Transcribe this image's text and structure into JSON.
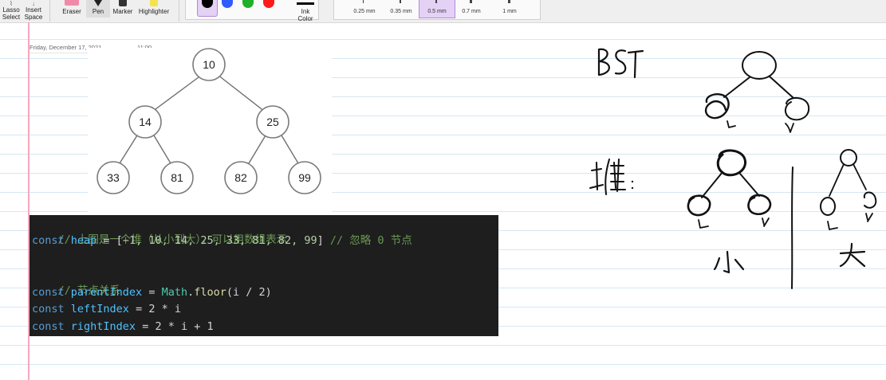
{
  "ribbon": {
    "lasso_label": "Lasso\nSelect",
    "lasso_line1": "Lasso",
    "lasso_line2": "Select",
    "insert_line1": "Insert",
    "insert_line2": "Space",
    "eraser_label": "Eraser",
    "pen_label": "Pen",
    "marker_label": "Marker",
    "highlighter_label": "Highlighter",
    "ink_color_line1": "Ink",
    "ink_color_line2": "Color",
    "colors": [
      "#000000",
      "#2f5bff",
      "#1fb02a",
      "#ff1a1a"
    ],
    "selected_color": "#000000",
    "thickness_options": [
      "0.25 mm",
      "0.35 mm",
      "0.5 mm",
      "0.7 mm",
      "1 mm"
    ],
    "selected_thickness": "0.5 mm"
  },
  "page": {
    "date": "Friday, December 17, 2021",
    "time": "11:00"
  },
  "heap_tree": {
    "nodes": [
      "10",
      "14",
      "25",
      "33",
      "81",
      "82",
      "99"
    ]
  },
  "code": {
    "line1_comment": "// 上图是一个堆（从小到大），可以用数组表示",
    "line2": {
      "kw": "const",
      "var": "heap",
      "eq": " = [",
      "values": "−1, 10, 14, 25, 33, 81, 82, 99",
      "close": "] ",
      "comment": "// 忽略 0 节点"
    },
    "line4_comment": "// 节点关系",
    "line5": {
      "kw": "const",
      "var": "parentIndex",
      "eq": " = ",
      "cls": "Math",
      "dot": ".",
      "fn": "floor",
      "rest": "(i / 2)"
    },
    "line6": {
      "kw": "const",
      "var": "leftIndex",
      "rest": " = 2 * i"
    },
    "line7": {
      "kw": "const",
      "var": "rightIndex",
      "rest": " = 2 * i + 1"
    }
  },
  "handwriting": {
    "bst": "BST",
    "bst_left": "L",
    "bst_right": "Y",
    "heap_glyph": "堆:",
    "min_left": "L",
    "min_right": "Y",
    "min_caption": "小",
    "max_left": "L",
    "max_right": "Y",
    "max_caption": "大"
  }
}
